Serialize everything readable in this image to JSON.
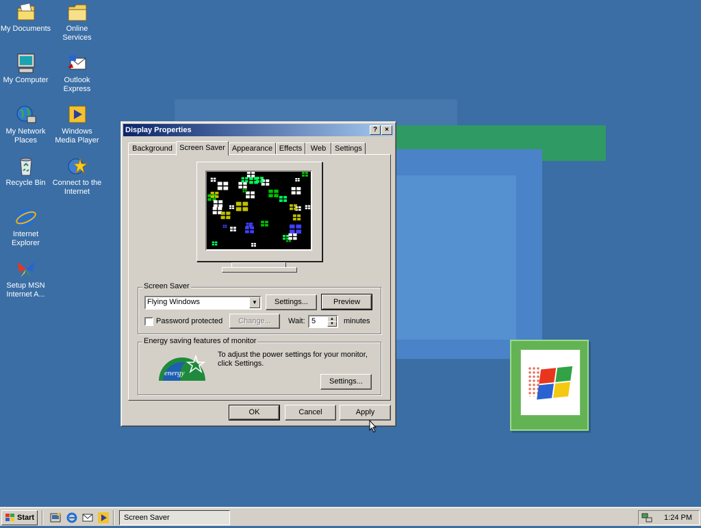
{
  "desktop": {
    "icons": [
      {
        "label": "My Documents",
        "icon": "my-documents-icon"
      },
      {
        "label": "Online Services",
        "icon": "folder-icon"
      },
      {
        "label": "My Computer",
        "icon": "my-computer-icon"
      },
      {
        "label": "Outlook Express",
        "icon": "outlook-express-icon"
      },
      {
        "label": "My Network Places",
        "icon": "network-places-icon"
      },
      {
        "label": "Windows Media Player",
        "icon": "media-player-icon"
      },
      {
        "label": "Recycle Bin",
        "icon": "recycle-bin-icon"
      },
      {
        "label": "Connect to the Internet",
        "icon": "connect-internet-icon"
      },
      {
        "label": "Internet Explorer",
        "icon": "internet-explorer-icon"
      },
      {
        "label": "Setup MSN Internet A...",
        "icon": "msn-butterfly-icon"
      }
    ]
  },
  "dialog": {
    "title": "Display Properties",
    "help_button": "?",
    "close_button": "×",
    "tabs": [
      "Background",
      "Screen Saver",
      "Appearance",
      "Effects",
      "Web",
      "Settings"
    ],
    "active_tab": "Screen Saver",
    "screensaver_group": {
      "legend": "Screen Saver",
      "selected": "Flying Windows",
      "settings_button": "Settings...",
      "preview_button": "Preview",
      "password_label": "Password protected",
      "password_checked": false,
      "change_button": "Change...",
      "wait_label": "Wait:",
      "wait_value": "5",
      "minutes_label": "minutes"
    },
    "energy_group": {
      "legend": "Energy saving features of monitor",
      "text": "To adjust the power settings for your monitor, click Settings.",
      "logo_text": "energy",
      "settings_button": "Settings..."
    },
    "buttons": {
      "ok": "OK",
      "cancel": "Cancel",
      "apply": "Apply"
    }
  },
  "taskbar": {
    "start_label": "Start",
    "quick_launch": [
      "show-desktop-icon",
      "internet-explorer-icon",
      "outlook-express-icon",
      "media-player-icon"
    ],
    "task_label": "Screen Saver",
    "clock": "1:24 PM"
  },
  "colors": {
    "desktop": "#3a6ea5",
    "title_active_start": "#0a246a",
    "title_active_end": "#a6caf0",
    "face": "#d4d0c8"
  }
}
